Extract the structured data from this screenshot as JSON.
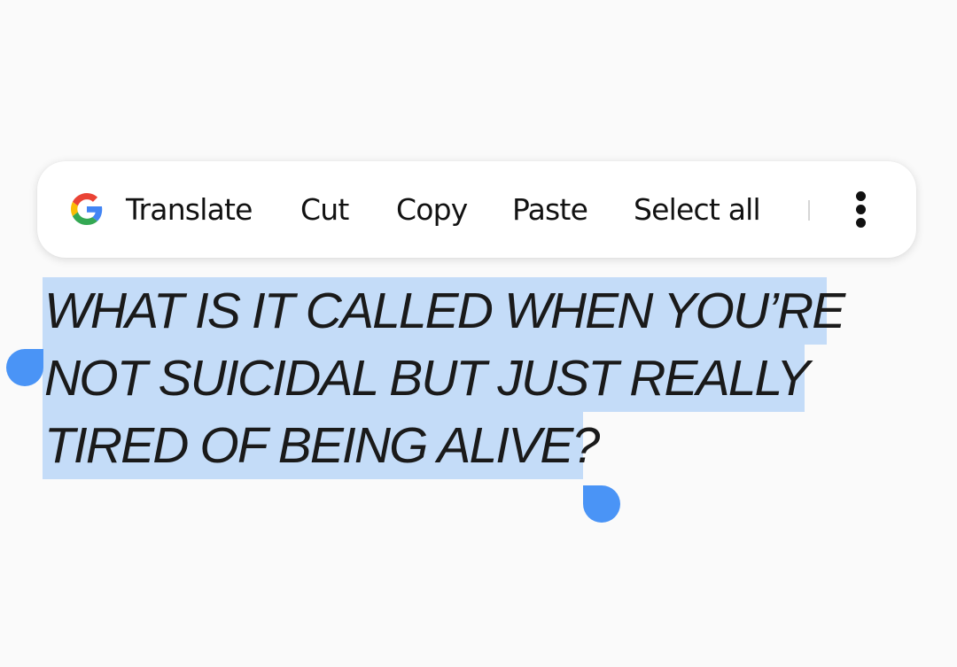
{
  "toolbar": {
    "translate_label": "Translate",
    "cut_label": "Cut",
    "copy_label": "Copy",
    "paste_label": "Paste",
    "select_all_label": "Select all",
    "logo_icon": "google-g-icon",
    "more_icon": "more-vertical-icon"
  },
  "content": {
    "lines": [
      "WHAT IS IT CALLED WHEN YOU’RE",
      "NOT SUICIDAL BUT JUST REALLY",
      "TIRED OF BEING ALIVE?"
    ]
  },
  "colors": {
    "selection_highlight": "#c4dcf8",
    "handle": "#4a94f6",
    "background": "#fafafa",
    "toolbar": "#ffffff",
    "google_blue": "#4285F4",
    "google_red": "#EA4335",
    "google_yellow": "#FBBC05",
    "google_green": "#34A853"
  }
}
